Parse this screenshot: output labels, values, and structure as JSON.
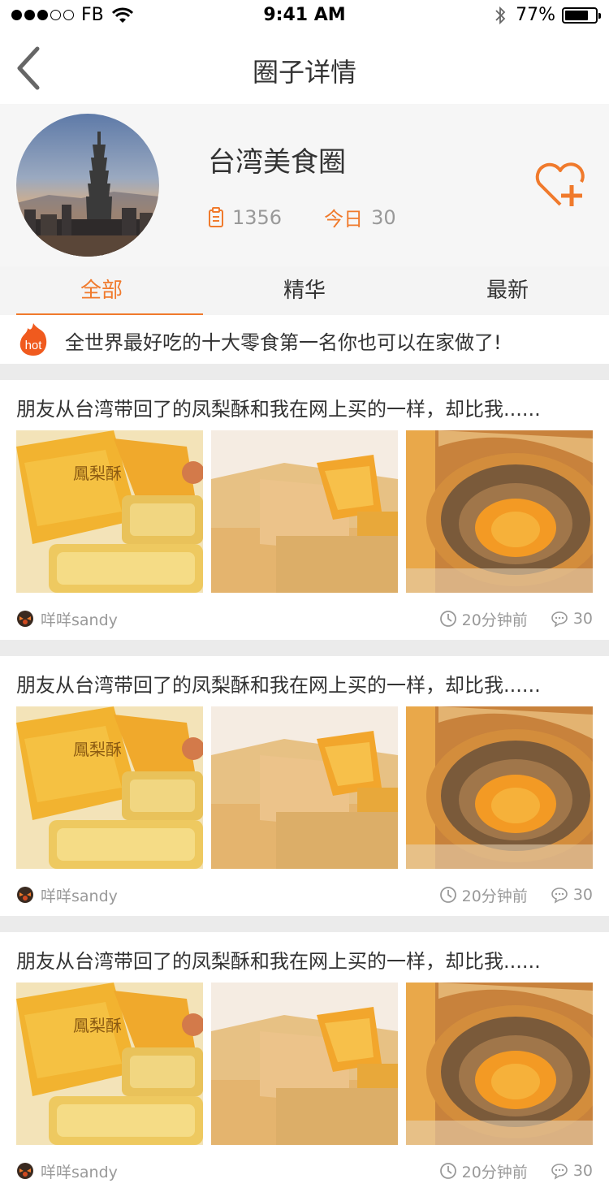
{
  "status_bar": {
    "carrier": "FB",
    "time": "9:41 AM",
    "battery": "77%",
    "battery_level": 0.77
  },
  "nav": {
    "title": "圈子详情"
  },
  "circle": {
    "name": "台湾美食圈",
    "post_count": "1356",
    "today_label": "今日",
    "today_count": "30"
  },
  "tabs": [
    {
      "label": "全部"
    },
    {
      "label": "精华"
    },
    {
      "label": "最新"
    }
  ],
  "hot": {
    "badge": "hot",
    "text": "全世界最好吃的十大零食第一名你也可以在家做了!"
  },
  "posts": [
    {
      "title": "朋友从台湾带回了的凤梨酥和我在网上买的一样，却比我......",
      "author": "咩咩sandy",
      "time": "20分钟前",
      "comments": "30"
    },
    {
      "title": "朋友从台湾带回了的凤梨酥和我在网上买的一样，却比我......",
      "author": "咩咩sandy",
      "time": "20分钟前",
      "comments": "30"
    },
    {
      "title": "朋友从台湾带回了的凤梨酥和我在网上买的一样，却比我......",
      "author": "咩咩sandy",
      "time": "20分钟前",
      "comments": "30"
    }
  ],
  "colors": {
    "accent": "#f07a2c",
    "text": "#333333",
    "muted": "#999999"
  }
}
